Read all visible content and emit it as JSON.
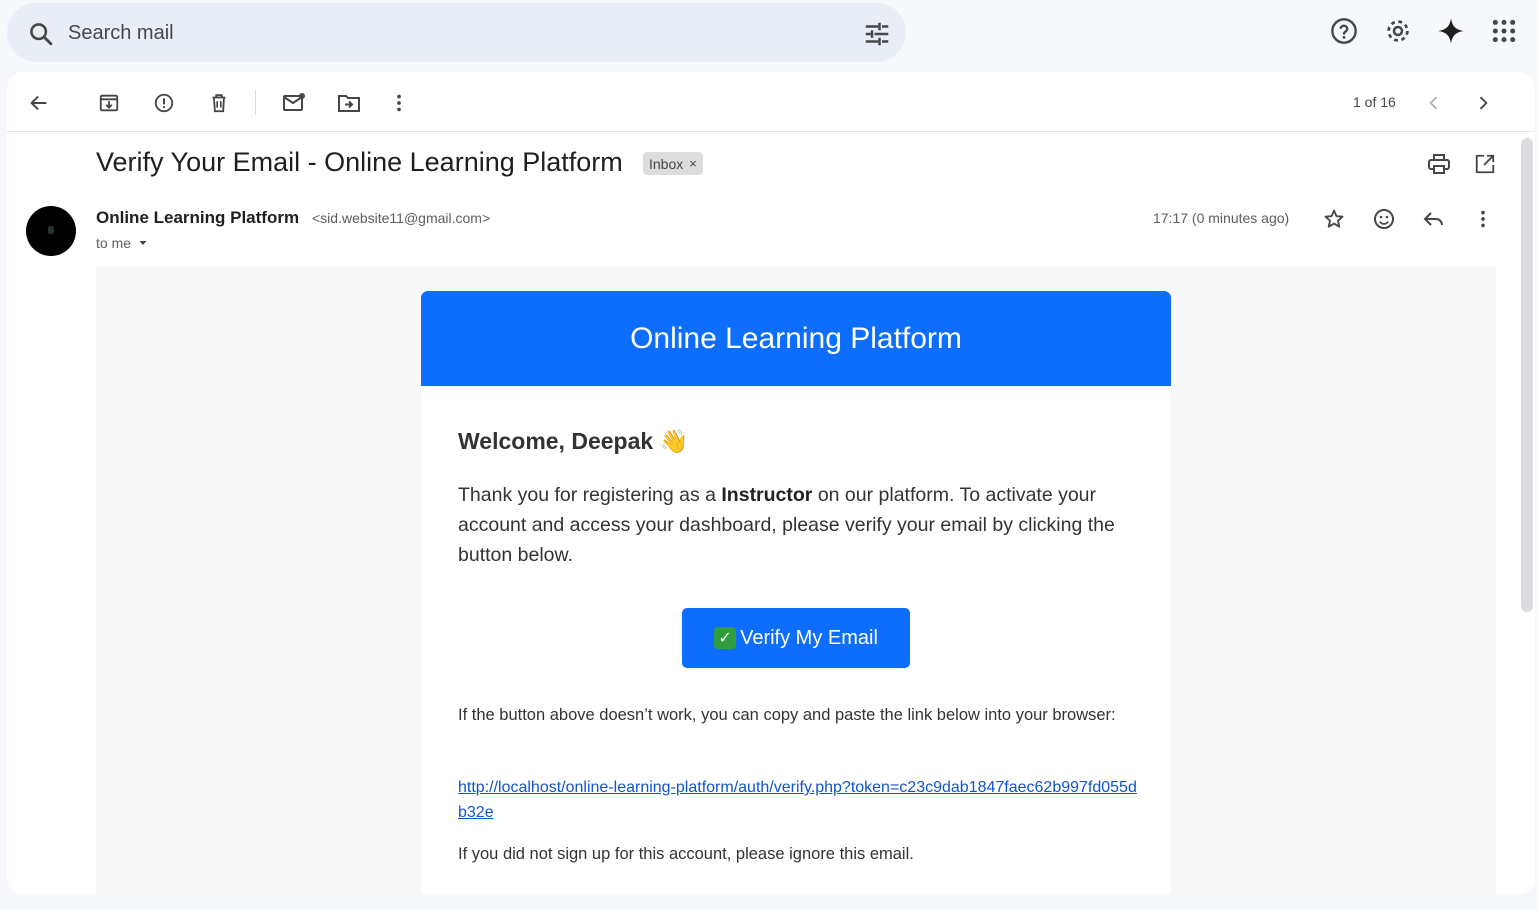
{
  "search": {
    "placeholder": "Search mail"
  },
  "toolbar": {
    "pager": "1 of 16"
  },
  "email": {
    "subject": "Verify Your Email - Online Learning Platform",
    "label": "Inbox",
    "label_remove": "×",
    "sender_name": "Online Learning Platform",
    "sender_email": "<sid.website11@gmail.com>",
    "recipient": "to me",
    "time": "17:17 (0 minutes ago)"
  },
  "body": {
    "header": "Online Learning Platform",
    "welcome": "Welcome, Deepak",
    "wave": "👋",
    "para_pre": "Thank you for registering as a ",
    "para_role": "Instructor",
    "para_post": " on our platform. To activate your account and access your dashboard, please verify your email by clicking the button below.",
    "button_check": "✓",
    "button_label": "Verify My Email",
    "fallback": "If the button above doesn’t work, you can copy and paste the link below into your browser:",
    "link": "http://localhost/online-learning-platform/auth/verify.php?token=c23c9dab1847faec62b997fd055db32e",
    "ignore": "If you did not sign up for this account, please ignore this email."
  },
  "colors": {
    "accent": "#0d6efd",
    "link": "#1155cc",
    "background": "#f6f8fc"
  },
  "icons": [
    "search-icon",
    "tune-icon",
    "help-icon",
    "settings-icon",
    "gemini-icon",
    "apps-icon",
    "back-icon",
    "archive-icon",
    "report-spam-icon",
    "delete-icon",
    "mark-unread-icon",
    "move-to-icon",
    "more-icon",
    "prev-icon",
    "next-icon",
    "print-icon",
    "open-new-window-icon",
    "star-icon",
    "emoji-icon",
    "reply-icon",
    "chevron-down-icon"
  ]
}
